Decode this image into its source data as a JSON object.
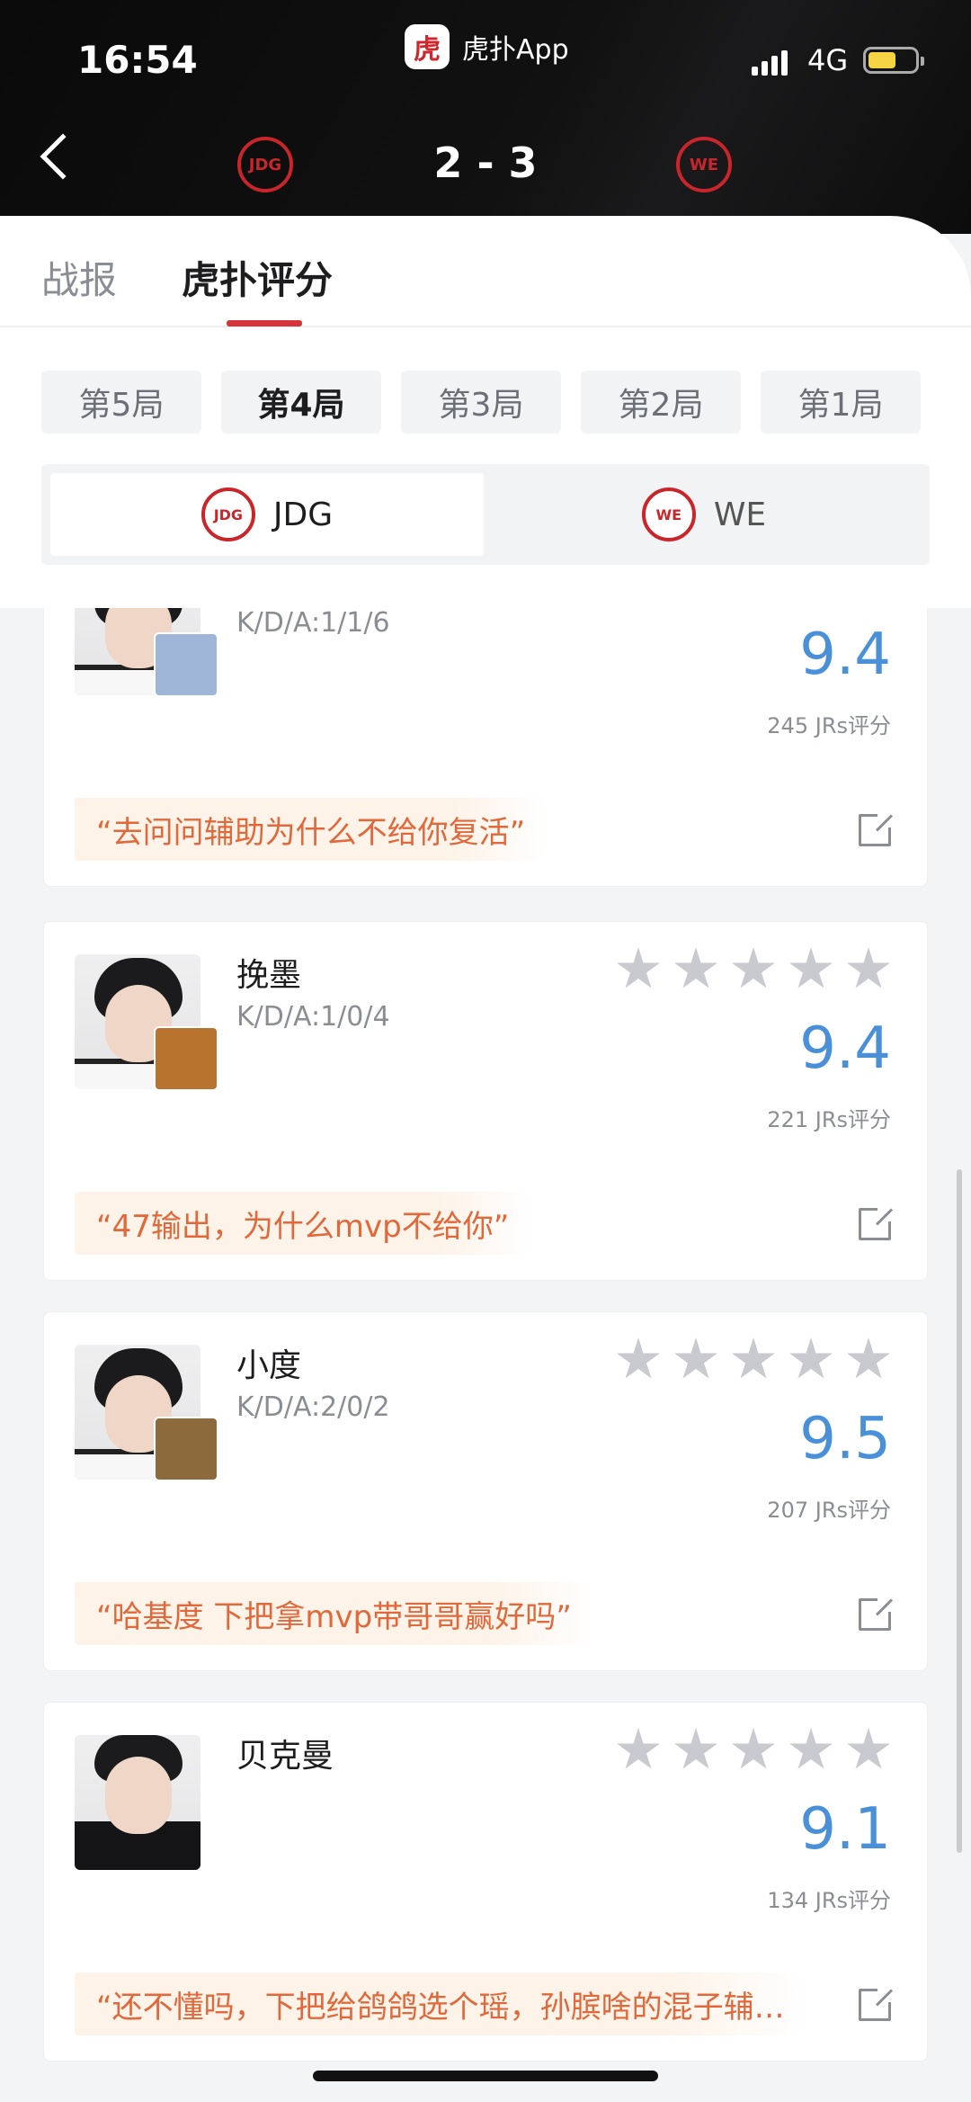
{
  "status_bar": {
    "time": "16:54",
    "network": "4G"
  },
  "app_badge": {
    "logo_text": "虎",
    "name": "虎扑App"
  },
  "match": {
    "score": "2 - 3",
    "home_logo": "JDG",
    "away_logo": "WE"
  },
  "tabs": [
    {
      "label": "战报"
    },
    {
      "label": "虎扑评分"
    }
  ],
  "rounds": [
    {
      "label": "第5局"
    },
    {
      "label": "第4局"
    },
    {
      "label": "第3局"
    },
    {
      "label": "第2局"
    },
    {
      "label": "第1局"
    }
  ],
  "teams": [
    {
      "label": "JDG",
      "logo": "JDG"
    },
    {
      "label": "WE",
      "logo": "WE"
    }
  ],
  "players": [
    {
      "name": "",
      "kda": "K/D/A:1/1/6",
      "rating": "9.4",
      "jrs": "245 JRs评分",
      "quote": "“去问问辅助为什么不给你复活”",
      "hero_color": "#9fb6d8",
      "stars": 5
    },
    {
      "name": "挽墨",
      "kda": "K/D/A:1/0/4",
      "rating": "9.4",
      "jrs": "221 JRs评分",
      "quote": "“47输出，为什么mvp不给你”",
      "hero_color": "#b8732f",
      "stars": 5
    },
    {
      "name": "小度",
      "kda": "K/D/A:2/0/2",
      "rating": "9.5",
      "jrs": "207 JRs评分",
      "quote": "“哈基度 下把拿mvp带哥哥赢好吗”",
      "hero_color": "#8c6a3c",
      "stars": 5
    },
    {
      "name": "贝克曼",
      "kda": "",
      "rating": "9.1",
      "jrs": "134 JRs评分",
      "quote": "“还不懂吗，下把给鸽鸽选个瑶，孙膑啥的混子辅…",
      "hero_color": "",
      "stars": 5
    }
  ],
  "colors": {
    "accent_red": "#d6333a",
    "rating_blue": "#4a90d9",
    "quote_orange": "#e0683a"
  }
}
